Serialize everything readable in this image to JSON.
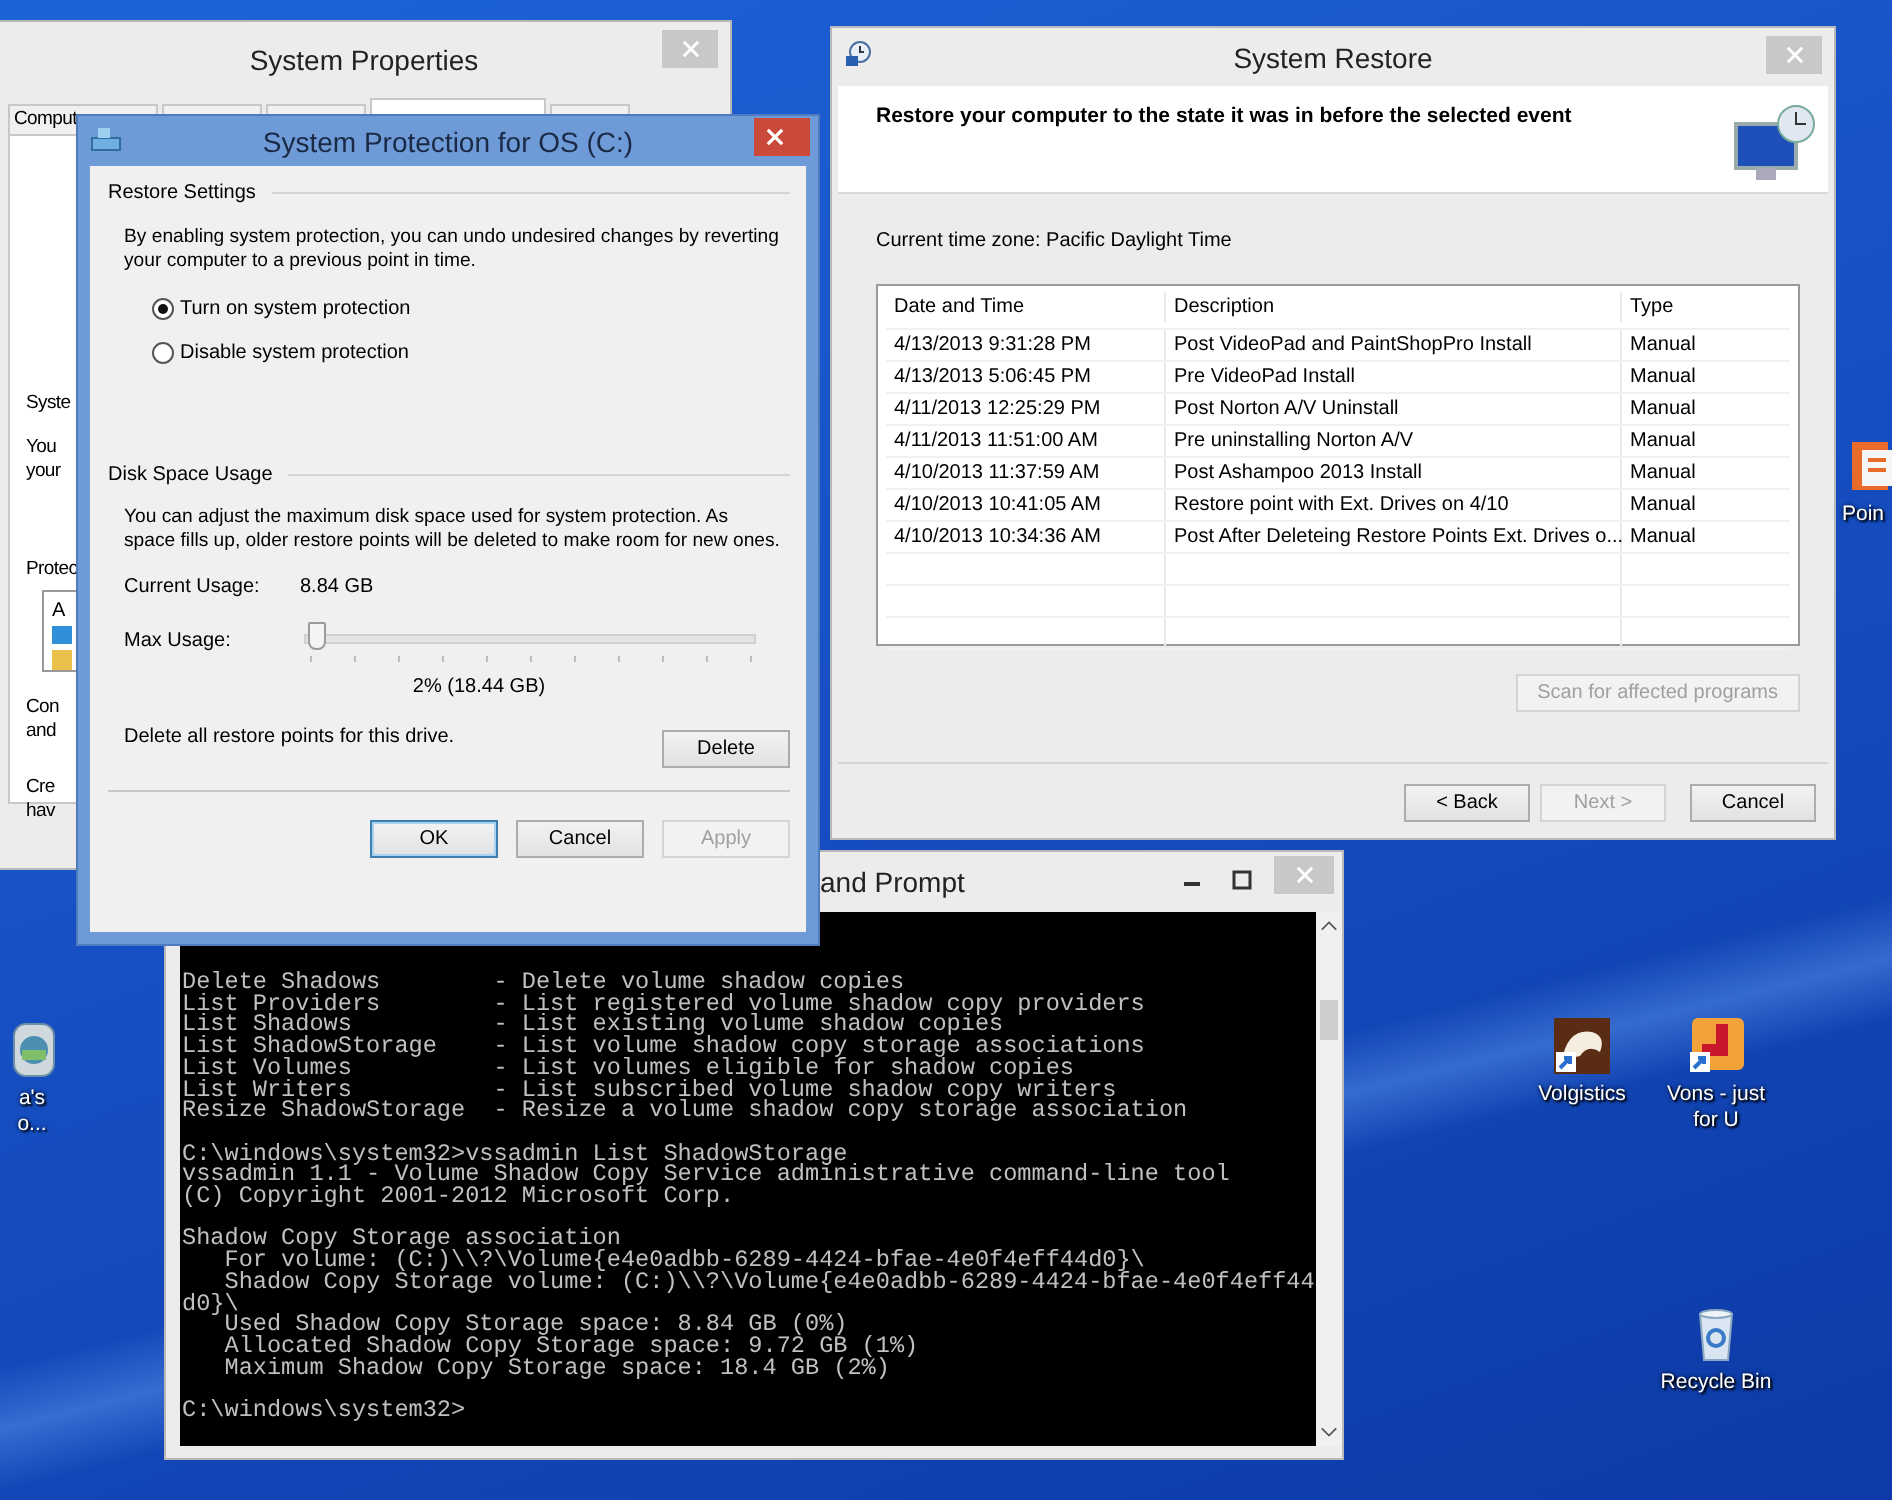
{
  "desktop_icons": [
    {
      "kind": "app",
      "lines": [
        "a's",
        "o..."
      ]
    },
    {
      "kind": "document",
      "lines": [
        "Poin"
      ]
    },
    {
      "kind": "volgistics",
      "lines": [
        "Volgistics"
      ]
    },
    {
      "kind": "vons",
      "lines": [
        "Vons - just",
        "for U"
      ]
    },
    {
      "kind": "recycle",
      "lines": [
        "Recycle Bin"
      ]
    }
  ],
  "system_properties": {
    "title": "System Properties",
    "tabs": [
      {
        "label": "Comput",
        "selected": false
      },
      {
        "selected": false
      },
      {
        "selected": false
      },
      {
        "selected": true
      },
      {
        "selected": false
      }
    ],
    "fragments": [
      {
        "lines": [
          "Syste"
        ]
      },
      {
        "lines": [
          "You",
          "your"
        ]
      },
      {
        "lines": [
          "Protec"
        ]
      },
      {
        "lines": [
          "Con",
          "and"
        ]
      },
      {
        "lines": [
          "Cre",
          "hav"
        ]
      }
    ],
    "list_fragment": "A"
  },
  "system_protection": {
    "title": "System Protection for OS (C:)",
    "restore_settings": {
      "heading": "Restore Settings",
      "text": "By enabling system protection, you can undo undesired changes by reverting your computer to a previous point in time.",
      "options": [
        {
          "label": "Turn on system protection",
          "selected": true
        },
        {
          "label": "Disable system protection",
          "selected": false
        }
      ]
    },
    "disk_space": {
      "heading": "Disk Space Usage",
      "text": "You can adjust the maximum disk space used for system protection. As space fills up, older restore points will be deleted to make room for new ones.",
      "current_usage_label": "Current Usage:",
      "current_usage": "8.84 GB",
      "max_usage_label": "Max Usage:",
      "max_usage": {
        "level": 0.02
      },
      "max_usage_reading": "2% (18.44 GB)",
      "delete_text": "Delete all restore points for this drive.",
      "delete_button": "Delete"
    },
    "buttons": [
      {
        "label": "OK",
        "default": true,
        "disabled": false
      },
      {
        "label": "Cancel",
        "default": false,
        "disabled": false
      },
      {
        "label": "Apply",
        "default": false,
        "disabled": true
      }
    ]
  },
  "system_restore": {
    "title": "System Restore",
    "header": "Restore your computer to the state it was in before the selected event",
    "timezone": "Current time zone: Pacific Daylight Time",
    "table": {
      "columns": [
        "Date and Time",
        "Description",
        "Type"
      ],
      "rows": [
        [
          "4/13/2013 9:31:28 PM",
          "Post VideoPad and PaintShopPro Install",
          "Manual"
        ],
        [
          "4/13/2013 5:06:45 PM",
          "Pre VideoPad Install",
          "Manual"
        ],
        [
          "4/11/2013 12:25:29 PM",
          "Post Norton A/V Uninstall",
          "Manual"
        ],
        [
          "4/11/2013 11:51:00 AM",
          "Pre uninstalling Norton A/V",
          "Manual"
        ],
        [
          "4/10/2013 11:37:59 AM",
          "Post Ashampoo 2013 Install",
          "Manual"
        ],
        [
          "4/10/2013 10:41:05 AM",
          "Restore point with Ext. Drives on 4/10",
          "Manual"
        ],
        [
          "4/10/2013 10:34:36 AM",
          "Post After Deleteing Restore Points Ext. Drives o...",
          "Manual"
        ]
      ]
    },
    "scan_button": {
      "label": "Scan for affected programs",
      "disabled": true
    },
    "buttons": [
      {
        "label": "< Back",
        "disabled": false
      },
      {
        "label": "Next >",
        "disabled": true
      },
      {
        "label": "Cancel",
        "disabled": false
      }
    ]
  },
  "command_prompt": {
    "title": "and Prompt",
    "blocks": [
      [
        "Delete Shadows        - Delete volume shadow copies",
        "List Providers        - List registered volume shadow copy providers",
        "List Shadows          - List existing volume shadow copies",
        "List ShadowStorage    - List volume shadow copy storage associations",
        "List Volumes          - List volumes eligible for shadow copies",
        "List Writers          - List subscribed volume shadow copy writers",
        "Resize ShadowStorage  - Resize a volume shadow copy storage association"
      ],
      [
        "C:\\windows\\system32>vssadmin List ShadowStorage",
        "vssadmin 1.1 - Volume Shadow Copy Service administrative command-line tool",
        "(C) Copyright 2001-2012 Microsoft Corp."
      ],
      [
        "Shadow Copy Storage association",
        "   For volume: (C:)\\\\?\\Volume{e4e0adbb-6289-4424-bfae-4e0f4eff44d0}\\",
        "   Shadow Copy Storage volume: (C:)\\\\?\\Volume{e4e0adbb-6289-4424-bfae-4e0f4eff44",
        "d0}\\",
        "   Used Shadow Copy Storage space: 8.84 GB (0%)",
        "   Allocated Shadow Copy Storage space: 9.72 GB (1%)",
        "   Maximum Shadow Copy Storage space: 18.4 GB (2%)"
      ],
      [
        "C:\\windows\\system32>"
      ]
    ]
  }
}
